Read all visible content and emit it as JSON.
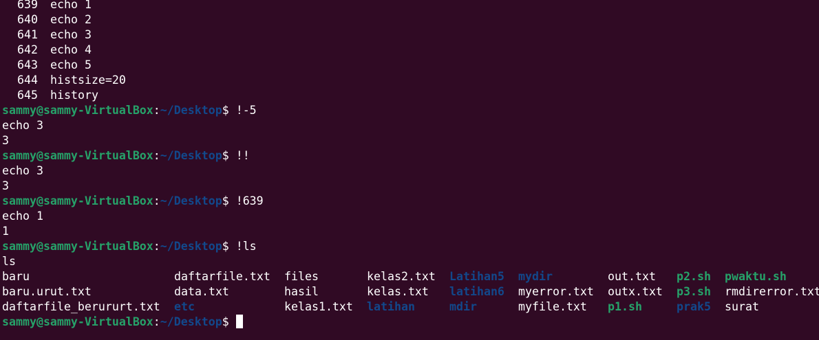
{
  "prompt": {
    "user_host": "sammy@sammy-VirtualBox",
    "colon": ":",
    "path": "~/Desktop",
    "dollar": "$ "
  },
  "history": [
    {
      "num": "639",
      "cmd": "echo 1"
    },
    {
      "num": "640",
      "cmd": "echo 2"
    },
    {
      "num": "641",
      "cmd": "echo 3"
    },
    {
      "num": "642",
      "cmd": "echo 4"
    },
    {
      "num": "643",
      "cmd": "echo 5"
    },
    {
      "num": "644",
      "cmd": "histsize=20"
    },
    {
      "num": "645",
      "cmd": "history"
    }
  ],
  "session": {
    "cmd1": "!-5",
    "cmd1_expanded": "echo 3",
    "cmd1_output": "3",
    "cmd2": "!!",
    "cmd2_expanded": "echo 3",
    "cmd2_output": "3",
    "cmd3": "!639",
    "cmd3_expanded": "echo 1",
    "cmd3_output": "1",
    "cmd4": "!ls",
    "cmd4_expanded": "ls"
  },
  "ls_rows": [
    [
      {
        "name": "baru",
        "type": "file"
      },
      {
        "name": "daftarfile.txt",
        "type": "file"
      },
      {
        "name": "files",
        "type": "file"
      },
      {
        "name": "kelas2.txt",
        "type": "file"
      },
      {
        "name": "Latihan5",
        "type": "dir"
      },
      {
        "name": "mydir",
        "type": "dir"
      },
      {
        "name": "out.txt",
        "type": "file"
      },
      {
        "name": "p2.sh",
        "type": "exec"
      },
      {
        "name": "pwaktu.sh",
        "type": "exec"
      }
    ],
    [
      {
        "name": "baru.urut.txt",
        "type": "file"
      },
      {
        "name": "data.txt",
        "type": "file"
      },
      {
        "name": "hasil",
        "type": "file"
      },
      {
        "name": "kelas.txt",
        "type": "file"
      },
      {
        "name": "latihan6",
        "type": "dir"
      },
      {
        "name": "myerror.txt",
        "type": "file"
      },
      {
        "name": "outx.txt",
        "type": "file"
      },
      {
        "name": "p3.sh",
        "type": "exec"
      },
      {
        "name": "rmdirerror.txt",
        "type": "file"
      }
    ],
    [
      {
        "name": "daftarfile_berururt.txt",
        "type": "file"
      },
      {
        "name": "etc",
        "type": "dir"
      },
      {
        "name": "kelas1.txt",
        "type": "file"
      },
      {
        "name": "latihan",
        "type": "dir"
      },
      {
        "name": "mdir",
        "type": "dir"
      },
      {
        "name": "myfile.txt",
        "type": "file"
      },
      {
        "name": "p1.sh",
        "type": "exec"
      },
      {
        "name": "prak5",
        "type": "dir"
      },
      {
        "name": "surat",
        "type": "file"
      }
    ]
  ],
  "colors": {
    "background": "#300a24",
    "prompt_user": "#26a269",
    "prompt_path": "#12488b",
    "directory": "#12488b",
    "executable": "#26a269",
    "text": "#ffffff"
  }
}
